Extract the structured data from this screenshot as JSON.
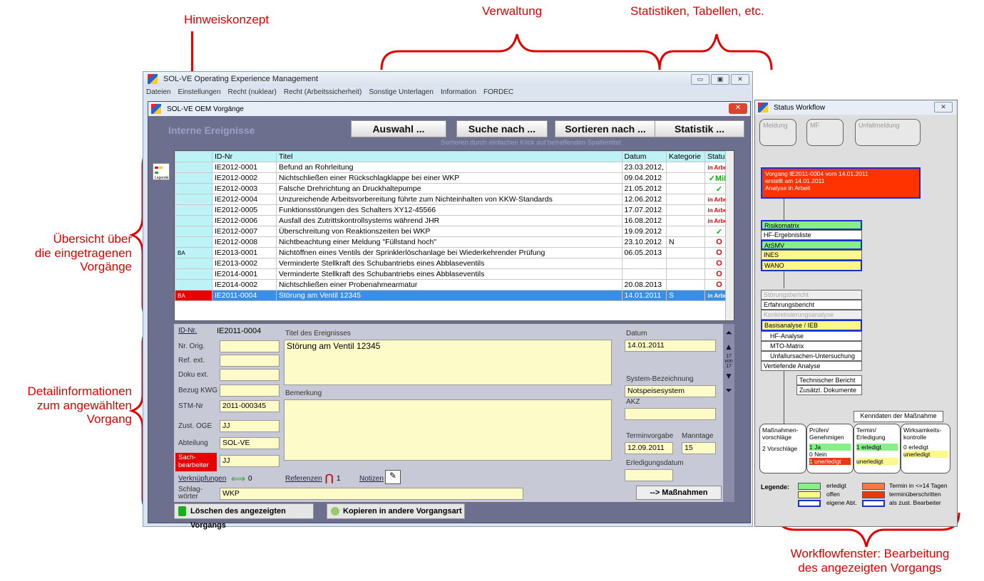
{
  "annotations": {
    "hinweis": "Hinweiskonzept",
    "verwaltung": "Verwaltung",
    "statistiken": "Statistiken, Tabellen, etc.",
    "uebersicht": [
      "Übersicht über",
      "die eingetragenen",
      "Vorgänge"
    ],
    "detail": [
      "Detailinformationen",
      "zum angewählten",
      "Vorgang"
    ],
    "workflow": [
      "Workflowfenster: Bearbeitung",
      "des angezeigten Vorgangs"
    ]
  },
  "app": {
    "title": "SOL-VE Operating Experience Management",
    "menu": [
      "Dateien",
      "Einstellungen",
      "Recht (nuklear)",
      "Recht (Arbeitssicherheit)",
      "Sonstige Unterlagen",
      "Information",
      "FORDEC"
    ]
  },
  "inner": {
    "title": "SOL-VE OEM Vorgänge",
    "heading": "Interne Ereignisse",
    "buttons": [
      "Auswahl ...",
      "Suche nach ...",
      "Sortieren nach ...",
      "Statistik ..."
    ],
    "sort_hint": "Sortieren durch einfachen Klick auf betreffenden Spaltentitel",
    "legend_icon": "Legende"
  },
  "table": {
    "headers": [
      "ID-Nr",
      "Titel",
      "Datum",
      "Kategorie",
      "Status"
    ],
    "rows": [
      {
        "side": "",
        "id": "IE2012-0001",
        "title": "Befund an Rohrleitung",
        "date": "23.03.2012,",
        "cat": "",
        "status": "in Arbeit",
        "stype": "red"
      },
      {
        "side": "",
        "id": "IE2012-0002",
        "title": "Nichtschließen einer Rückschlagklappe bei einer WKP",
        "date": "09.04.2012",
        "cat": "",
        "status": "✓MiR",
        "stype": "green"
      },
      {
        "side": "",
        "id": "IE2012-0003",
        "title": "Falsche Drehrichtung an Druckhaltepumpe",
        "date": "21.05.2012",
        "cat": "",
        "status": "✓",
        "stype": "green"
      },
      {
        "side": "",
        "id": "IE2012-0004",
        "title": "Unzureichende Arbeitsvorbereitung führte zum Nichteinhalten von KKW-Standards",
        "date": "12.06.2012",
        "cat": "",
        "status": "in Arbeit",
        "stype": "red"
      },
      {
        "side": "",
        "id": "IE2012-0005",
        "title": "Funktionsstörungen des Schalters XY12-45566",
        "date": "17.07.2012",
        "cat": "",
        "status": "in Arbeit",
        "stype": "red"
      },
      {
        "side": "",
        "id": "IE2012-0006",
        "title": "Ausfall des Zutrittskontrollsystems während JHR",
        "date": "16.08.2012",
        "cat": "",
        "status": "in Arbeit",
        "stype": "red"
      },
      {
        "side": "",
        "id": "IE2012-0007",
        "title": "Überschreitung von Reaktionszeiten bei WKP",
        "date": "19.09.2012",
        "cat": "",
        "status": "✓",
        "stype": "green"
      },
      {
        "side": "",
        "id": "IE2012-0008",
        "title": "Nichtbeachtung einer Meldung \"Füllstand hoch\"",
        "date": "23.10.2012",
        "cat": "N",
        "status": "O",
        "stype": "red"
      },
      {
        "side": "BA",
        "id": "IE2013-0001",
        "title": "Nichtöffnen eines Ventils der Sprinklerlöschanlage bei Wiederkehrender Prüfung",
        "date": "06.05.2013",
        "cat": "",
        "status": "O",
        "stype": "red"
      },
      {
        "side": "",
        "id": "IE2013-0002",
        "title": "Verminderte Stellkraft des Schubantriebs eines Abblaseventils",
        "date": "",
        "cat": "",
        "status": "O",
        "stype": "red"
      },
      {
        "side": "",
        "id": "IE2014-0001",
        "title": "Verminderte Stellkraft des Schubantriebs eines Abblaseventils",
        "date": "",
        "cat": "",
        "status": "O",
        "stype": "red"
      },
      {
        "side": "",
        "id": "IE2014-0002",
        "title": "Nichtschließen einer Probenahmearmatur",
        "date": "20.08.2013",
        "cat": "",
        "status": "O",
        "stype": "red"
      },
      {
        "side": "BA",
        "id": "IE2011-0004",
        "title": "Störung am Ventil 12345",
        "date": "14.01.2011",
        "cat": "S",
        "status": "in Arbeit",
        "stype": "red",
        "sel": true
      }
    ]
  },
  "detail": {
    "id_label": "ID-Nr.",
    "id_value": "IE2011-0004",
    "nr_orig": "Nr. Orig.",
    "ref_ext": "Ref. ext.",
    "doku_ext": "Doku ext.",
    "bezug": "Bezug KWG",
    "stm_label": "STM-Nr",
    "stm_value": "2011-000345",
    "zust_label": "Zust. OGE",
    "zust_value": "JJ",
    "abt_label": "Abteilung",
    "abt_value": "SOL-VE",
    "sach_label": "Sach-\nbearbeiter",
    "sach_value": "JJ",
    "titel_label": "Titel des Ereignisses",
    "titel_value": "Störung am Ventil 12345",
    "bemerkung_label": "Bemerkung",
    "datum_label": "Datum",
    "datum_value": "14.01.2011",
    "system_label": "System-Bezeichnung",
    "system_value": "Notspeisesystem",
    "akz_label": "AKZ",
    "termin_label": "Terminvorgabe",
    "termin_value": "12.09.2011",
    "mann_label": "Manntage",
    "mann_value": "15",
    "erl_label": "Erledigungsdatum",
    "verk_label": "Verknüpfungen",
    "verk_count": "0",
    "ref_label": "Referenzen",
    "ref_count": "1",
    "notizen_label": "Notizen",
    "schlag_label": "Schlag-\nwörter",
    "schlag_value": "WKP",
    "massnahmen_btn": "--> Maßnahmen",
    "counter": "17\nvon\n17",
    "delete_btn": "Löschen des angezeigten Vorgangs",
    "copy_btn": "Kopieren in andere Vorgangsart"
  },
  "workflow": {
    "title": "Status Workflow",
    "top": [
      "Meldung",
      "MF",
      "Unfallmeldung"
    ],
    "vorgang": [
      "Vorgang  IE2011-0004  vom  14.01.2011",
      "erstellt am 14.01.2011",
      "Analyse in Arbeit"
    ],
    "list1": [
      "Risikomatrix",
      "HF-Ergebnisliste",
      "AtSMV",
      "INES",
      "WANO"
    ],
    "list2": [
      "Störungsbericht",
      "Erfahrungsbericht",
      "Konkretisierungsanalyse",
      "Basisanalyse / IEB",
      "HF-Analyse",
      "MTO-Matrix",
      "Unfallursachen-Untersuchung",
      "Vertiefende Analyse"
    ],
    "sub": [
      "Technischer Bericht",
      "Zusätzl. Dokumente"
    ],
    "kenndaten": "Kenndaten der Maßnahme",
    "cols": [
      {
        "t": "Maßnahmen-\nvorschläge",
        "v": "2 Vorschläge"
      },
      {
        "t": "Prüfen/\nGenehmigen",
        "v": "1 Ja"
      },
      {
        "t": "Termin/\nErledigung",
        "v": "1 erledigt"
      },
      {
        "t": "Wirksamkeits-\nkontrolle",
        "v": "0 erledigt"
      }
    ],
    "pruef_nein": "0 Nein",
    "pruef_unerl": "1 unerledigt",
    "termin_unerl": "unerledigt",
    "wirk_unerl": "unerledigt",
    "legend_label": "Legende:",
    "legend": [
      "erledigt",
      "offen",
      "eigene Abt.",
      "Termin in <=14 Tagen",
      "terminüberschritten",
      "als zust. Bearbeiter"
    ]
  }
}
